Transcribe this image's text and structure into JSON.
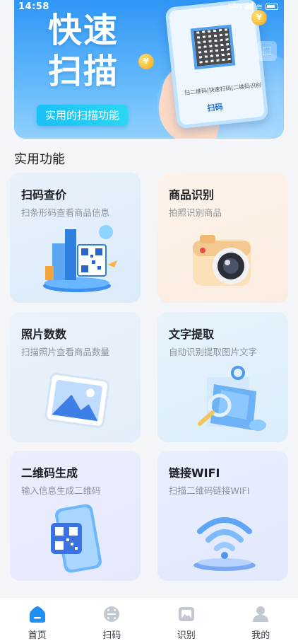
{
  "status_bar": {
    "time": "14:58",
    "speed": "KB/s"
  },
  "banner": {
    "title_line1": "快速",
    "title_line2": "扫描",
    "subtitle": "实用的扫描功能",
    "phone_text": "扫二维码|快速扫码|二维码识别",
    "phone_button": "扫码"
  },
  "section": {
    "title": "实用功能"
  },
  "cards": [
    {
      "title": "扫码查价",
      "desc": "扫条形码查看商品信息"
    },
    {
      "title": "商品识别",
      "desc": "拍照识别商品"
    },
    {
      "title": "照片数数",
      "desc": "扫描照片查看商品数量"
    },
    {
      "title": "文字提取",
      "desc": "自动识别提取图片文字"
    },
    {
      "title": "二维码生成",
      "desc": "输入信息生成二维码"
    },
    {
      "title": "链接WIFI",
      "desc": "扫描二维码链接WIFI"
    }
  ],
  "nav": {
    "items": [
      {
        "label": "首页",
        "icon": "home-icon"
      },
      {
        "label": "扫码",
        "icon": "scan-icon"
      },
      {
        "label": "识别",
        "icon": "recognize-icon"
      },
      {
        "label": "我的",
        "icon": "profile-icon"
      }
    ],
    "active": "首页"
  },
  "colors": {
    "primary": "#2f96f6",
    "nav_active": "#1e8ff0",
    "nav_inactive": "#a9aeb6"
  }
}
